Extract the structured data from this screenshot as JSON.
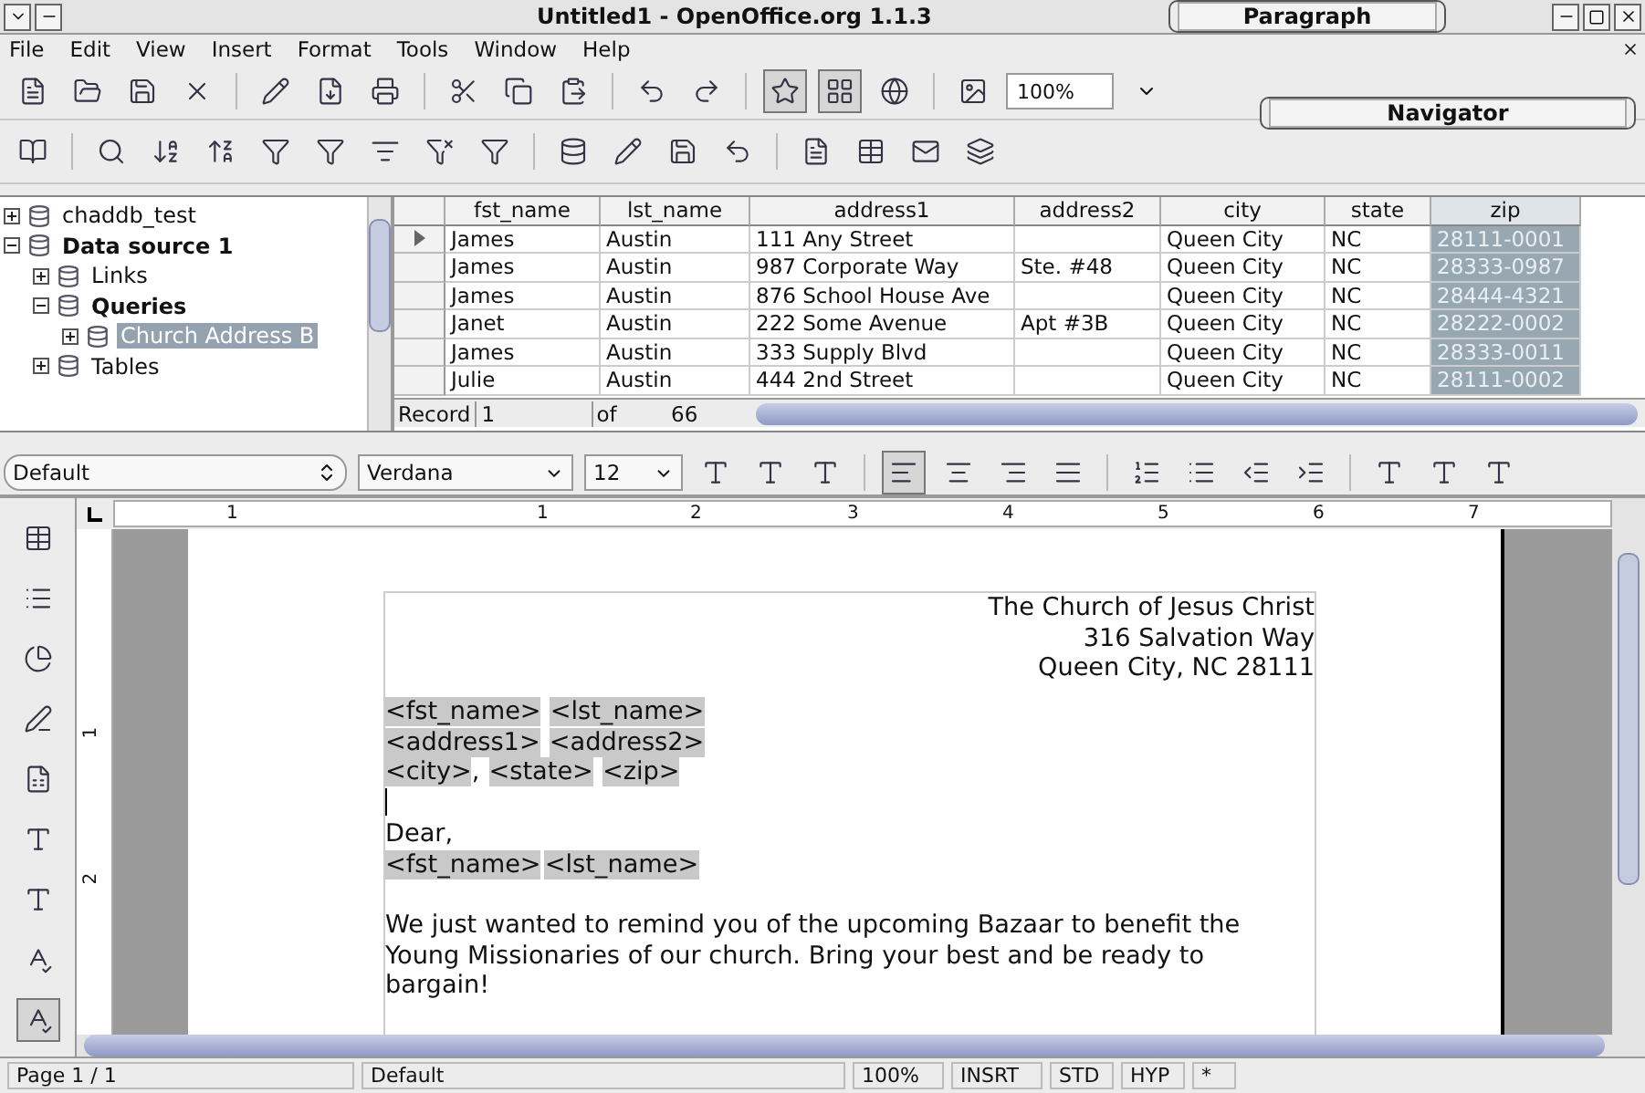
{
  "window": {
    "title": "Untitled1 - OpenOffice.org 1.1.3"
  },
  "floating_panels": [
    {
      "title": "Paragraph"
    },
    {
      "title": "Navigator"
    }
  ],
  "menu": [
    "File",
    "Edit",
    "View",
    "Insert",
    "Format",
    "Tools",
    "Window",
    "Help"
  ],
  "zoom_box": {
    "value": "100%"
  },
  "datasource_tree": [
    {
      "label": "chaddb_test",
      "expanded": false,
      "selected": false
    },
    {
      "label": "Data source 1",
      "expanded": true,
      "selected": false,
      "children": [
        {
          "label": "Links",
          "expanded": false,
          "selected": false
        },
        {
          "label": "Queries",
          "expanded": true,
          "selected": false,
          "children": [
            {
              "label": "Church Address B",
              "expanded": false,
              "selected": true
            }
          ]
        },
        {
          "label": "Tables",
          "expanded": false,
          "selected": false
        }
      ]
    }
  ],
  "grid": {
    "columns": [
      {
        "label": "fst_name",
        "selected": false
      },
      {
        "label": "lst_name",
        "selected": false
      },
      {
        "label": "address1",
        "selected": false
      },
      {
        "label": "address2",
        "selected": false
      },
      {
        "label": "city",
        "selected": false
      },
      {
        "label": "state",
        "selected": false
      },
      {
        "label": "zip",
        "selected": true
      }
    ],
    "rows": [
      {
        "current": true,
        "cells": [
          "James",
          "Austin",
          "111 Any Street",
          "",
          "Queen City",
          "NC",
          "28111-0001"
        ]
      },
      {
        "current": false,
        "cells": [
          "James",
          "Austin",
          "987 Corporate Way",
          "Ste. #48",
          "Queen City",
          "NC",
          "28333-0987"
        ]
      },
      {
        "current": false,
        "cells": [
          "James",
          "Austin",
          "876 School House Ave",
          "",
          "Queen City",
          "NC",
          "28444-4321"
        ]
      },
      {
        "current": false,
        "cells": [
          "Janet",
          "Austin",
          "222 Some Avenue",
          "Apt #3B",
          "Queen City",
          "NC",
          "28222-0002"
        ]
      },
      {
        "current": false,
        "cells": [
          "James",
          "Austin",
          "333 Supply Blvd",
          "",
          "Queen City",
          "NC",
          "28333-0011"
        ]
      },
      {
        "current": false,
        "cells": [
          "Julie",
          "Austin",
          "444 2nd Street",
          "",
          "Queen City",
          "NC",
          "28111-0002"
        ]
      }
    ],
    "record_label": "Record",
    "record_value": "1",
    "of_label": "of",
    "record_count": "66"
  },
  "formatting": {
    "style": "Default",
    "font": "Verdana",
    "size": "12"
  },
  "ruler": {
    "labels": [
      "1",
      "1",
      "2",
      "3",
      "4",
      "5",
      "6",
      "7"
    ],
    "vertical_labels": [
      "1",
      "2"
    ]
  },
  "document": {
    "sender": [
      "The Church of Jesus Christ",
      "316 Salvation Way",
      "Queen City, NC 28111"
    ],
    "address_lines": [
      [
        {
          "text": "<fst_name>",
          "field": true
        },
        {
          "text": "<lst_name>",
          "field": true
        }
      ],
      [
        {
          "text": "<address1>",
          "field": true
        },
        {
          "text": "<address2>",
          "field": true
        }
      ],
      [
        {
          "text": "<city>",
          "field": true
        },
        {
          "text": ",",
          "field": false
        },
        {
          "text": "<state>",
          "field": true
        },
        {
          "text": "<zip>",
          "field": true
        }
      ]
    ],
    "salutation": "Dear,",
    "name_line": [
      {
        "text": "<fst_name>",
        "field": true
      },
      {
        "text": "<lst_name>",
        "field": true
      }
    ],
    "paragraph": "We just wanted to remind you of the upcoming Bazaar to benefit the Young Missionaries of our church.  Bring your best and be ready to bargain!"
  },
  "status_bar": [
    "Page 1 / 1",
    "Default",
    "100%",
    "INSRT",
    "STD",
    "HYP",
    "*"
  ]
}
